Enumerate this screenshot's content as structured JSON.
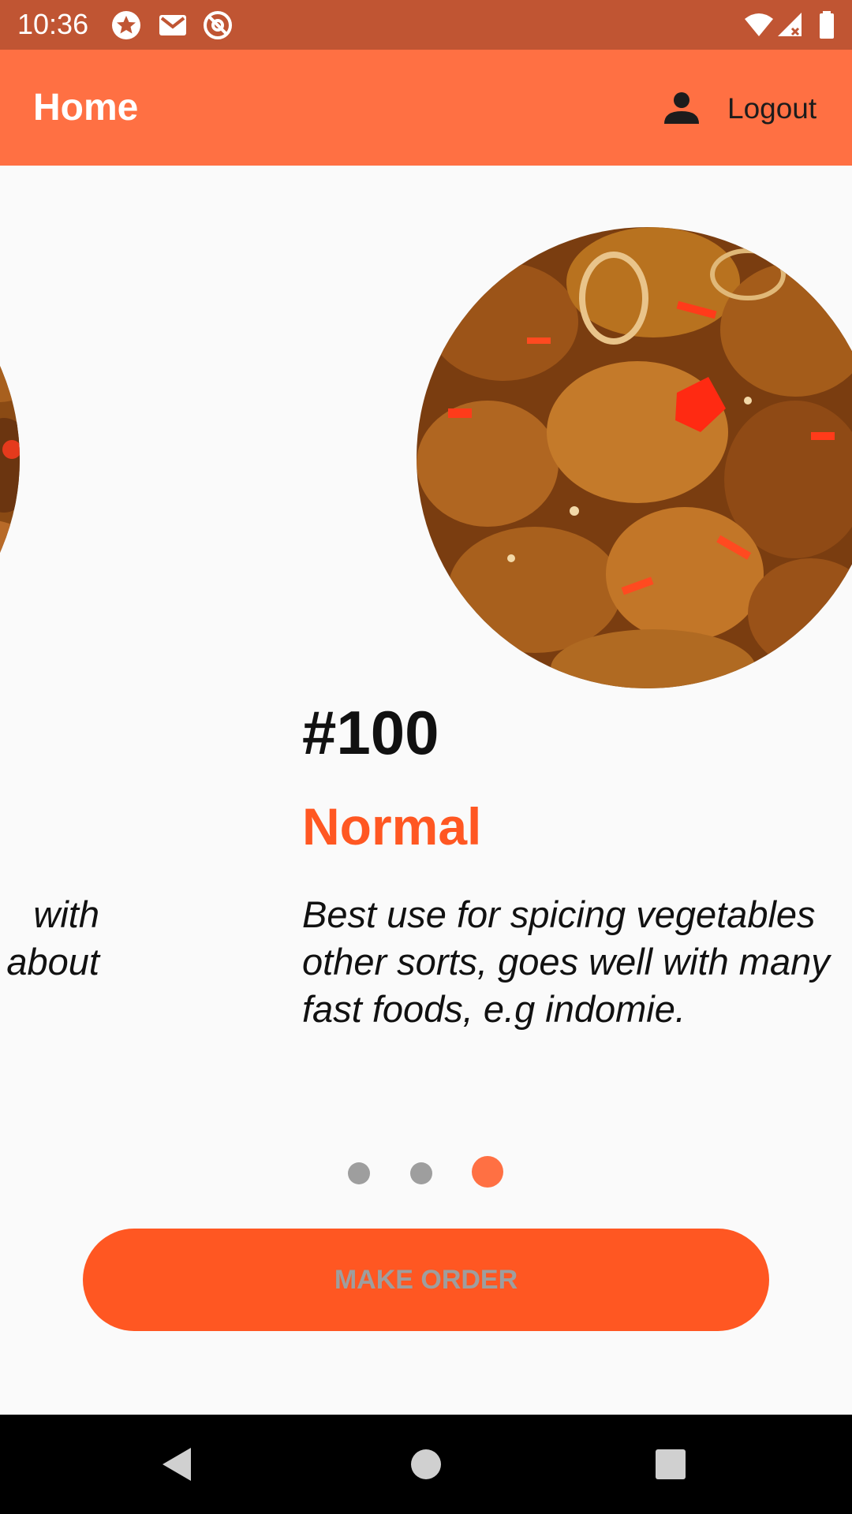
{
  "status_bar": {
    "time": "10:36",
    "icons": [
      "star-circle-icon",
      "gmail-icon",
      "at-sign-icon",
      "wifi-icon",
      "signal-icon",
      "battery-icon"
    ]
  },
  "app_bar": {
    "title": "Home",
    "logout_label": "Logout",
    "logout_icon": "person-icon"
  },
  "carousel": {
    "items": [
      {
        "description": "with\nabout"
      },
      {
        "price": "#100",
        "category": "Normal",
        "description": "Best use for spicing vegetables\nother sorts, goes well with many\nfast foods, e.g indomie."
      }
    ],
    "page_count": 3,
    "active_page": 3
  },
  "order_button": {
    "label": "MAKE ORDER"
  },
  "colors": {
    "status_bar": "#c05533",
    "app_bar": "#ff7043",
    "accent": "#ff5722",
    "dot_inactive": "#9e9e9e"
  },
  "nav_bar": {
    "icons": [
      "back-icon",
      "home-icon",
      "recents-icon"
    ]
  }
}
